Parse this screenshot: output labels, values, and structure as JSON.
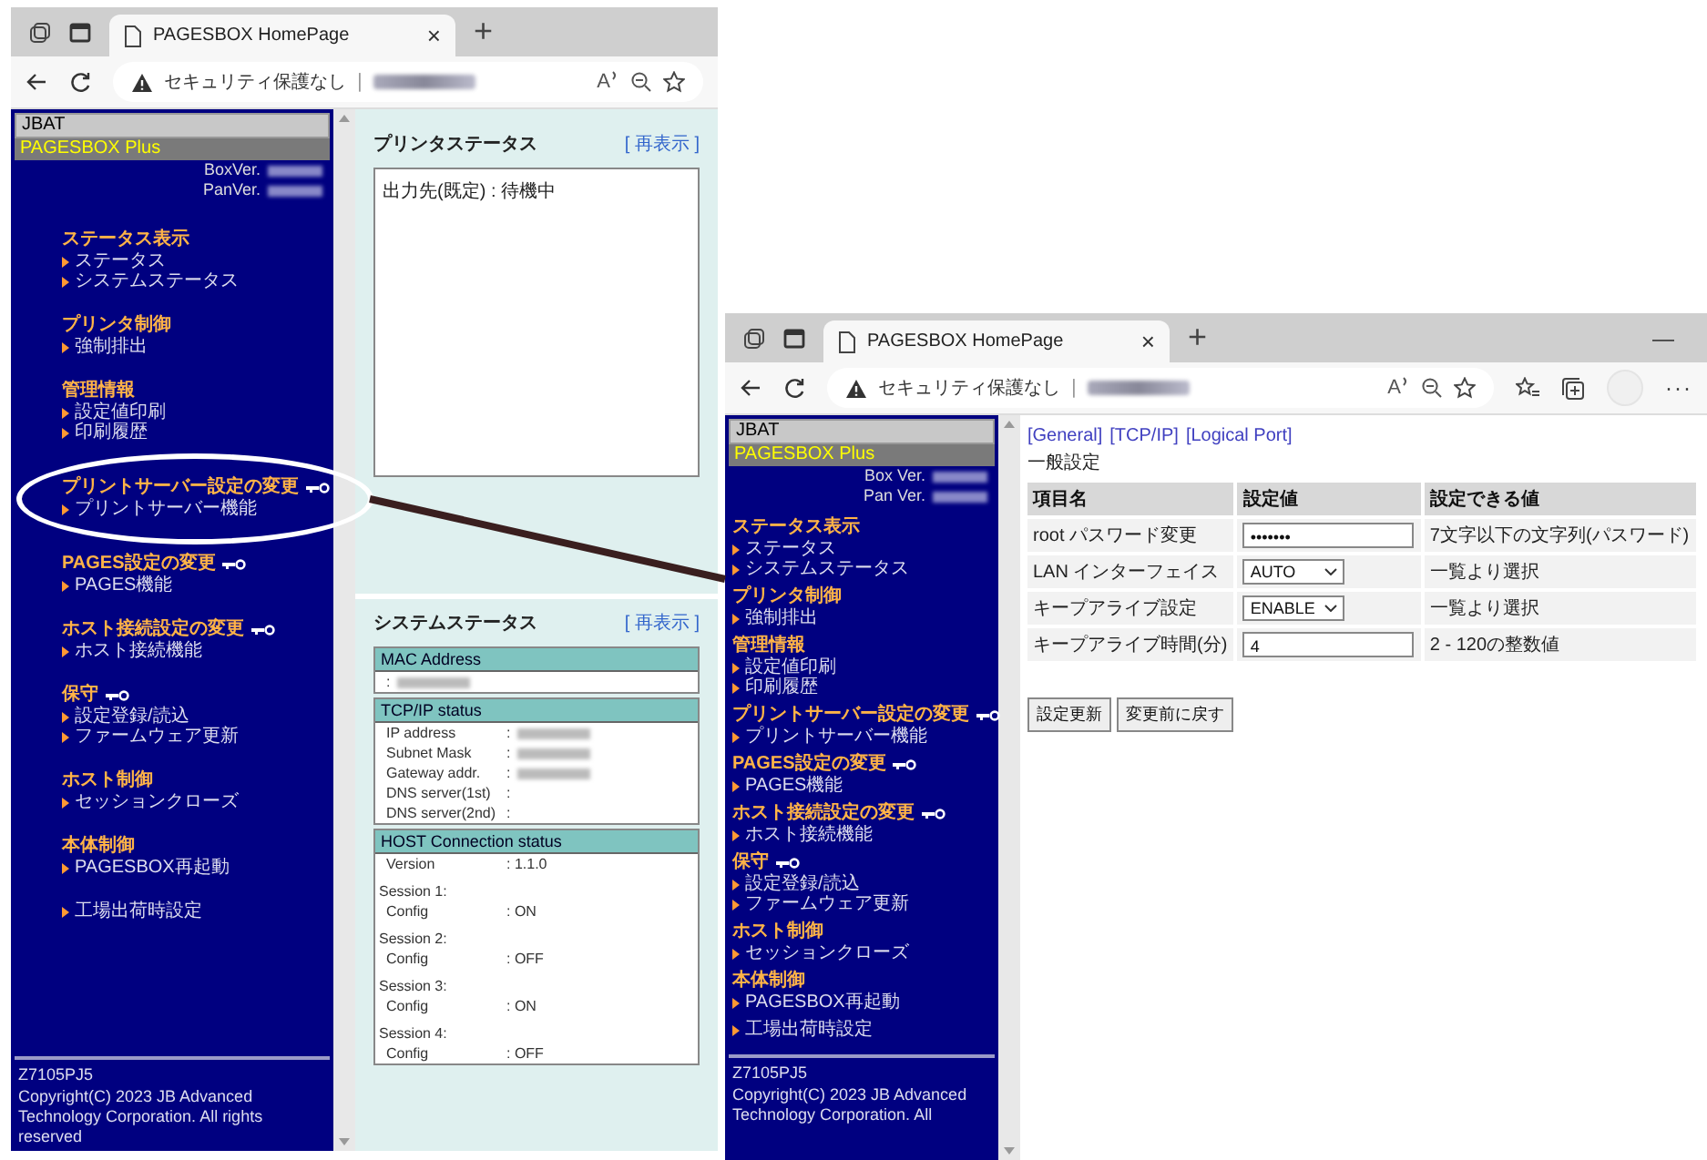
{
  "windows": [
    {
      "full": false,
      "tab_title": "PAGESBOX HomePage",
      "close": "×",
      "new_tab": "+",
      "security": "セキュリティ保護なし",
      "separator": "|",
      "read_aloud": "A",
      "sidebar": {
        "vendor": "JBAT",
        "product": "PAGESBOX Plus",
        "versions": [
          "BoxVer.",
          "PanVer."
        ],
        "sections": [
          {
            "title": "ステータス表示",
            "locked": false,
            "circled": false,
            "links": [
              "ステータス",
              "システムステータス"
            ]
          },
          {
            "title": "プリンタ制御",
            "locked": false,
            "circled": false,
            "links": [
              "強制排出"
            ]
          },
          {
            "title": "管理情報",
            "locked": false,
            "circled": false,
            "links": [
              "設定値印刷",
              "印刷履歴"
            ]
          },
          {
            "title": "プリントサーバー設定の変更",
            "locked": true,
            "circled": true,
            "links": [
              "プリントサーバー機能"
            ]
          },
          {
            "title": "PAGES設定の変更",
            "locked": true,
            "circled": false,
            "links": [
              "PAGES機能"
            ]
          },
          {
            "title": "ホスト接続設定の変更",
            "locked": true,
            "circled": false,
            "links": [
              "ホスト接続機能"
            ]
          },
          {
            "title": "保守",
            "locked": true,
            "circled": false,
            "links": [
              "設定登録/読込",
              "ファームウェア更新"
            ]
          },
          {
            "title": "ホスト制御",
            "locked": false,
            "circled": false,
            "links": [
              "セッションクローズ"
            ]
          },
          {
            "title": "本体制御",
            "locked": false,
            "circled": false,
            "links": [
              "PAGESBOX再起動"
            ]
          },
          {
            "locked": false,
            "circled": false,
            "links": [
              "工場出荷時設定"
            ]
          }
        ],
        "model": "Z7105PJ5",
        "copyright": "Copyright(C) 2023 JB Advanced Technology Corporation. All rights reserved"
      },
      "content": {
        "kind": "status",
        "printer": {
          "title": "プリンタステータス",
          "refresh": "[ 再表示 ]",
          "message": "出力先(既定) : 待機中"
        },
        "system": {
          "title": "システムステータス",
          "refresh": "[ 再表示 ]",
          "groups": [
            {
              "title": "MAC Address",
              "rows": [
                {
                  "value": ":",
                  "masked": true
                }
              ]
            },
            {
              "title": "TCP/IP status",
              "rows": [
                {
                  "label": "IP address",
                  "value": ":",
                  "masked": true
                },
                {
                  "label": "Subnet Mask",
                  "value": ":",
                  "masked": true
                },
                {
                  "label": "Gateway addr.",
                  "value": ":",
                  "masked": true
                },
                {
                  "label": "DNS server(1st)",
                  "value": ":"
                },
                {
                  "label": "DNS server(2nd)",
                  "value": ":"
                }
              ]
            },
            {
              "title": "HOST Connection status",
              "rows": [
                {
                  "label": "Version",
                  "value": ": 1.1.0"
                },
                {
                  "label": "Session 1:",
                  "heading": true
                },
                {
                  "label": "Config",
                  "value": ": ON"
                },
                {
                  "label": "Session 2:",
                  "heading": true
                },
                {
                  "label": "Config",
                  "value": ": OFF"
                },
                {
                  "label": "Session 3:",
                  "heading": true
                },
                {
                  "label": "Config",
                  "value": ": ON"
                },
                {
                  "label": "Session 4:",
                  "heading": true
                },
                {
                  "label": "Config",
                  "value": ": OFF"
                }
              ]
            }
          ]
        }
      }
    },
    {
      "full": true,
      "tab_title": "PAGESBOX HomePage",
      "close": "×",
      "new_tab": "+",
      "minimize": "—",
      "security": "セキュリティ保護なし",
      "separator": "|",
      "read_aloud": "A",
      "more": "···",
      "sidebar": {
        "vendor": "JBAT",
        "product": "PAGESBOX Plus",
        "versions": [
          "Box Ver.",
          "Pan Ver."
        ],
        "sections": [
          {
            "title": "ステータス表示",
            "locked": false,
            "circled": false,
            "links": [
              "ステータス",
              "システムステータス"
            ]
          },
          {
            "title": "プリンタ制御",
            "locked": false,
            "circled": false,
            "links": [
              "強制排出"
            ]
          },
          {
            "title": "管理情報",
            "locked": false,
            "circled": false,
            "links": [
              "設定値印刷",
              "印刷履歴"
            ]
          },
          {
            "title": "プリントサーバー設定の変更",
            "locked": true,
            "circled": false,
            "links": [
              "プリントサーバー機能"
            ]
          },
          {
            "title": "PAGES設定の変更",
            "locked": true,
            "circled": false,
            "links": [
              "PAGES機能"
            ]
          },
          {
            "title": "ホスト接続設定の変更",
            "locked": true,
            "circled": false,
            "links": [
              "ホスト接続機能"
            ]
          },
          {
            "title": "保守",
            "locked": true,
            "circled": false,
            "links": [
              "設定登録/読込",
              "ファームウェア更新"
            ]
          },
          {
            "title": "ホスト制御",
            "locked": false,
            "circled": false,
            "links": [
              "セッションクローズ"
            ]
          },
          {
            "title": "本体制御",
            "locked": false,
            "circled": false,
            "links": [
              "PAGESBOX再起動"
            ]
          },
          {
            "locked": false,
            "circled": false,
            "links": [
              "工場出荷時設定"
            ]
          }
        ],
        "model": "Z7105PJ5",
        "copyright": "Copyright(C) 2023 JB Advanced Technology Corporation. All"
      },
      "content": {
        "kind": "settings",
        "links": [
          "[General]",
          "[TCP/IP]",
          "[Logical Port]"
        ],
        "heading": "一般設定",
        "columns": [
          "項目名",
          "設定値",
          "設定できる値"
        ],
        "rows": [
          {
            "name": "root パスワード変更",
            "kind": "password",
            "value": "•••••••",
            "allowed": "7文字以下の文字列(パスワード)"
          },
          {
            "name": "LAN インターフェイス",
            "kind": "select",
            "value": "AUTO",
            "allowed": "一覧より選択"
          },
          {
            "name": "キープアライブ設定",
            "kind": "select",
            "value": "ENABLE",
            "allowed": "一覧より選択"
          },
          {
            "name": "キープアライブ時間(分)",
            "kind": "text",
            "value": "4",
            "allowed": "2 - 120の整数値"
          }
        ],
        "buttons": [
          "設定更新",
          "変更前に戻す"
        ]
      }
    }
  ]
}
